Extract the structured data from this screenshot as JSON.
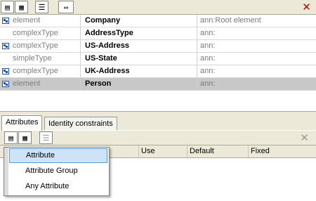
{
  "grid": {
    "rows": [
      {
        "type": "element",
        "name": "Company",
        "ann": "ann:Root element",
        "selected": false
      },
      {
        "type": "complexType",
        "name": "AddressType",
        "ann": "ann:",
        "selected": false
      },
      {
        "type": "complexType",
        "name": "US-Address",
        "ann": "ann:",
        "selected": false
      },
      {
        "type": "simpleType",
        "name": "US-State",
        "ann": "ann:",
        "selected": false
      },
      {
        "type": "complexType",
        "name": "UK-Address",
        "ann": "ann:",
        "selected": false
      },
      {
        "type": "element",
        "name": "Person",
        "ann": "ann:",
        "selected": true
      }
    ]
  },
  "tabs": [
    {
      "label": "Attributes",
      "active": true
    },
    {
      "label": "Identity constraints",
      "active": false
    }
  ],
  "attr_columns": {
    "use": "Use",
    "default": "Default",
    "fixed": "Fixed"
  },
  "context_menu": {
    "items": [
      {
        "label": "Attribute",
        "highlighted": true
      },
      {
        "label": "Attribute Group",
        "highlighted": false
      },
      {
        "label": "Any Attribute",
        "highlighted": false
      }
    ]
  },
  "icons": {
    "top_toolbar": [
      "insert-icon",
      "append-icon",
      "delete-icon",
      "reorder-icon",
      "close-icon"
    ],
    "bottom_toolbar": [
      "insert-icon",
      "append-icon",
      "delete-icon",
      "close-icon"
    ]
  },
  "colors": {
    "selected_row": "#c8c8c8",
    "menu_highlight": "#cde3f9",
    "close_red": "#c00000"
  }
}
